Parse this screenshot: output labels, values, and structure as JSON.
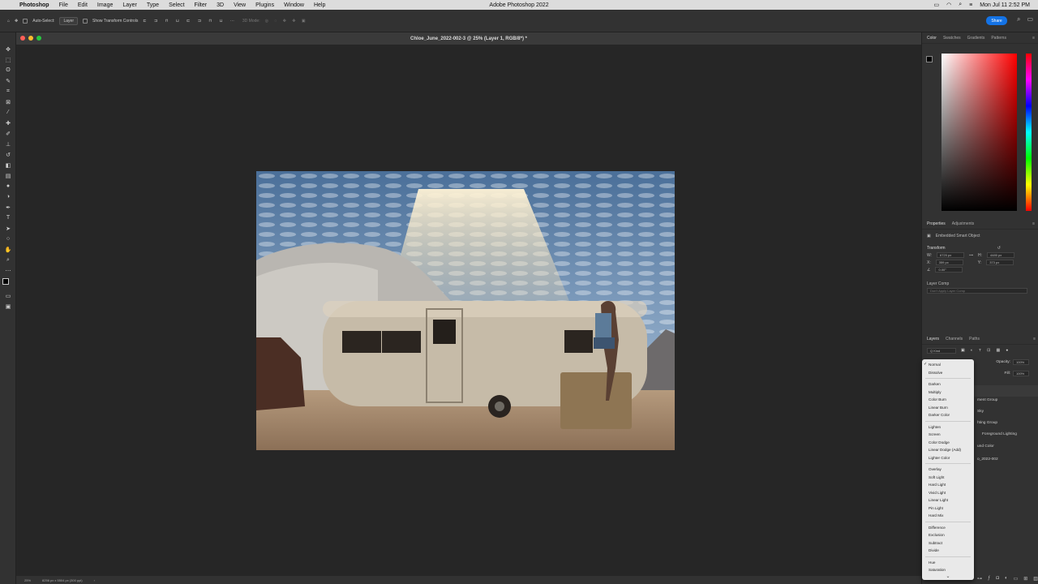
{
  "menubar": {
    "apple": "",
    "app": "Photoshop",
    "items": [
      "File",
      "Edit",
      "Image",
      "Layer",
      "Type",
      "Select",
      "Filter",
      "3D",
      "View",
      "Plugins",
      "Window",
      "Help"
    ],
    "center_title": "Adobe Photoshop 2022",
    "clock": "Mon Jul 11  2:52 PM"
  },
  "options": {
    "auto_select_label": "Auto-Select:",
    "auto_select_value": "Layer",
    "show_transform_label": "Show Transform Controls",
    "mode_label": "3D Mode:",
    "share_label": "Share"
  },
  "document": {
    "title": "Chloe_June_2022-002-3 @ 25% (Layer 1, RGB/8*) *"
  },
  "statusbar": {
    "zoom": "25%",
    "size": "8256 px x 5504 px (300 ppi)"
  },
  "color_panel": {
    "tabs": [
      "Color",
      "Swatches",
      "Gradients",
      "Patterns"
    ]
  },
  "properties": {
    "tabs": [
      "Properties",
      "Adjustments"
    ],
    "object_type": "Embedded Smart Object",
    "transform_label": "Transform",
    "w_label": "W:",
    "w_value": "6720 px",
    "h_label": "H:",
    "h_value": "4480 px",
    "x_label": "X:",
    "x_value": "359 px",
    "y_label": "Y:",
    "y_value": "373 px",
    "angle_value": "0.00°",
    "layer_comp_label": "Layer Comp",
    "layer_comp_value": "Don't Apply Layer Comp"
  },
  "layers": {
    "tabs": [
      "Layers",
      "Channels",
      "Paths"
    ],
    "kind": "Q Kind",
    "opacity_label": "Opacity:",
    "opacity_value": "100%",
    "fill_label": "Fill:",
    "fill_value": "100%",
    "rows": [
      "ment Group",
      "Sky",
      "hting Group",
      "Foreground Lighting",
      "und Color",
      "o_2022-002"
    ]
  },
  "blend_menu": {
    "groups": [
      [
        "Normal",
        "Dissolve"
      ],
      [
        "Darken",
        "Multiply",
        "Color Burn",
        "Linear Burn",
        "Darker Color"
      ],
      [
        "Lighten",
        "Screen",
        "Color Dodge",
        "Linear Dodge (Add)",
        "Lighter Color"
      ],
      [
        "Overlay",
        "Soft Light",
        "Hard Light",
        "Vivid Light",
        "Linear Light",
        "Pin Light",
        "Hard Mix"
      ],
      [
        "Difference",
        "Exclusion",
        "Subtract",
        "Divide"
      ],
      [
        "Hue",
        "Saturation"
      ]
    ],
    "checked": "Normal"
  },
  "icons": {
    "tools": [
      "move-icon",
      "marquee-icon",
      "lasso-icon",
      "quick-select-icon",
      "crop-icon",
      "frame-icon",
      "eyedropper-icon",
      "healing-icon",
      "brush-icon",
      "stamp-icon",
      "history-brush-icon",
      "eraser-icon",
      "gradient-icon",
      "blur-icon",
      "dodge-icon",
      "pen-icon",
      "type-icon",
      "path-select-icon",
      "shape-icon",
      "hand-icon",
      "zoom-icon"
    ]
  }
}
